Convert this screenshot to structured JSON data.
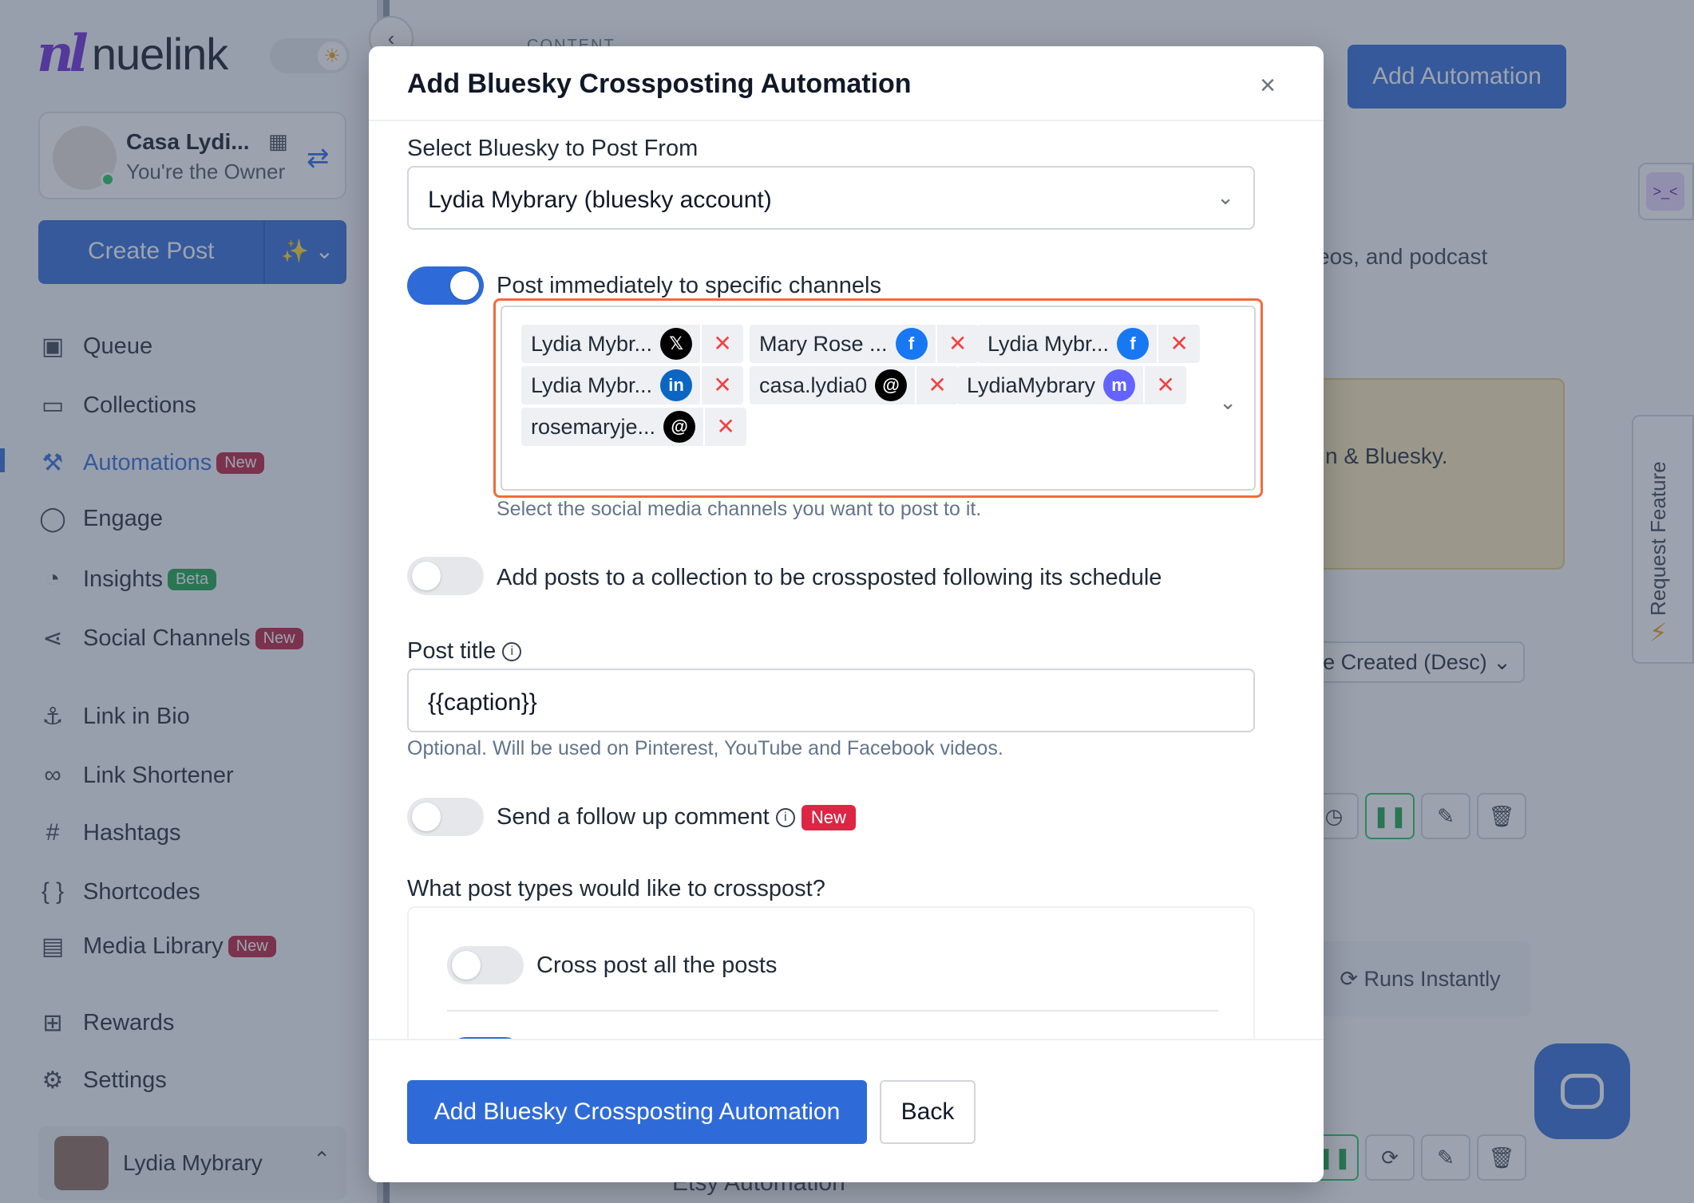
{
  "sidebar": {
    "logo_mark": "nl",
    "logo_text": "nuelink",
    "theme_icon": "sun-icon",
    "workspace_name": "Casa Lydi...",
    "workspace_role": "You're the Owner",
    "create_post": "Create Post",
    "create_ai": "✨ ⌄",
    "nav": [
      {
        "label": "Queue",
        "icon": "calendar-icon",
        "glyph": "▣",
        "badge": ""
      },
      {
        "label": "Collections",
        "icon": "folder-icon",
        "glyph": "▭",
        "badge": ""
      },
      {
        "label": "Automations",
        "icon": "magic-wand-icon",
        "glyph": "⚒",
        "badge": "New"
      },
      {
        "label": "Engage",
        "icon": "chat-icon",
        "glyph": "◯",
        "badge": ""
      },
      {
        "label": "Insights",
        "icon": "pie-chart-icon",
        "glyph": "◔",
        "badge": "Beta"
      },
      {
        "label": "Social Channels",
        "icon": "share-icon",
        "glyph": "⋖",
        "badge": "New"
      },
      {
        "label": "Link in Bio",
        "icon": "anchor-icon",
        "glyph": "⚓",
        "badge": ""
      },
      {
        "label": "Link Shortener",
        "icon": "link-icon",
        "glyph": "∞",
        "badge": ""
      },
      {
        "label": "Hashtags",
        "icon": "hash-icon",
        "glyph": "#",
        "badge": ""
      },
      {
        "label": "Shortcodes",
        "icon": "braces-icon",
        "glyph": "{ }",
        "badge": ""
      },
      {
        "label": "Media Library",
        "icon": "images-icon",
        "glyph": "▤",
        "badge": "New"
      },
      {
        "label": "Rewards",
        "icon": "gift-icon",
        "glyph": "⊞",
        "badge": ""
      },
      {
        "label": "Settings",
        "icon": "gear-icon",
        "glyph": "⚙",
        "badge": ""
      }
    ],
    "user_name": "Lydia Mybrary"
  },
  "main": {
    "content_label": "CONTENT",
    "add_automation": "Add Automation",
    "desc_fragment": "eos, and podcast",
    "banner_fragment": "n & Bluesky.",
    "sort_label": "e Created (Desc)  ⌄",
    "runs_instantly": "⟳  Runs Instantly",
    "etsy_fragment": "Etsy Automation",
    "request_feature": "Request Feature"
  },
  "modal": {
    "title": "Add Bluesky Crossposting Automation",
    "close": "×",
    "select_label": "Select Bluesky to Post From",
    "select_value": "Lydia Mybrary (bluesky account)",
    "post_immediately_label": "Post immediately to specific channels",
    "post_immediately_on": true,
    "channels": [
      {
        "name": "Lydia Mybr...",
        "network": "x",
        "glyph": "𝕏"
      },
      {
        "name": "Mary Rose ...",
        "network": "fb",
        "glyph": "f"
      },
      {
        "name": "Lydia Mybr...",
        "network": "fb",
        "glyph": "f"
      },
      {
        "name": "Lydia Mybr...",
        "network": "li",
        "glyph": "in"
      },
      {
        "name": "casa.lydia0",
        "network": "th",
        "glyph": "@"
      },
      {
        "name": "LydiaMybrary",
        "network": "ma",
        "glyph": "m"
      },
      {
        "name": "rosemaryje...",
        "network": "th",
        "glyph": "@"
      }
    ],
    "channels_help": "Select the social media channels you want to post to it.",
    "collection_label": "Add posts to a collection to be crossposted following its schedule",
    "collection_on": false,
    "post_title_label": "Post title",
    "post_title_value": "{{caption}}",
    "post_title_help": "Optional. Will be used on Pinterest, YouTube and Facebook videos.",
    "follow_up_label": "Send a follow up comment",
    "follow_up_badge": "New",
    "follow_up_on": false,
    "post_types_label": "What post types would like to crosspost?",
    "cross_all_label": "Cross post all the posts",
    "cross_all_on": false,
    "submit_label": "Add Bluesky Crossposting Automation",
    "back_label": "Back"
  }
}
